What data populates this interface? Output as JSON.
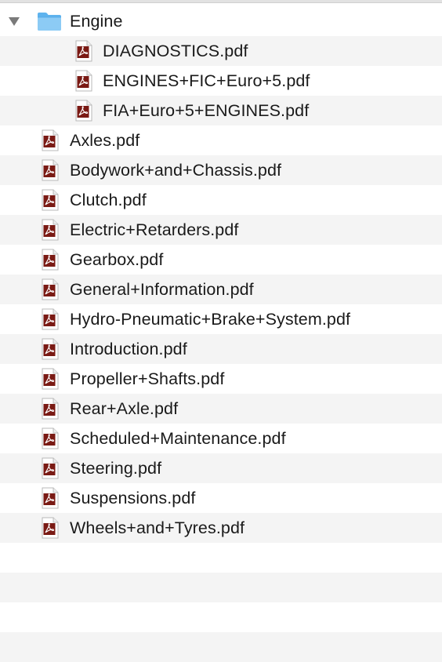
{
  "folder": {
    "name": "Engine",
    "expanded": true,
    "icon": "folder-icon",
    "color": "#6fbdf2",
    "children": [
      {
        "name": "DIAGNOSTICS.pdf",
        "icon": "pdf-icon"
      },
      {
        "name": "ENGINES+FIC+Euro+5.pdf",
        "icon": "pdf-icon"
      },
      {
        "name": "FIA+Euro+5+ENGINES.pdf",
        "icon": "pdf-icon"
      }
    ]
  },
  "files": [
    {
      "name": "Axles.pdf",
      "icon": "pdf-icon"
    },
    {
      "name": "Bodywork+and+Chassis.pdf",
      "icon": "pdf-icon"
    },
    {
      "name": "Clutch.pdf",
      "icon": "pdf-icon"
    },
    {
      "name": "Electric+Retarders.pdf",
      "icon": "pdf-icon"
    },
    {
      "name": "Gearbox.pdf",
      "icon": "pdf-icon"
    },
    {
      "name": "General+Information.pdf",
      "icon": "pdf-icon"
    },
    {
      "name": "Hydro-Pneumatic+Brake+System.pdf",
      "icon": "pdf-icon"
    },
    {
      "name": "Introduction.pdf",
      "icon": "pdf-icon"
    },
    {
      "name": "Propeller+Shafts.pdf",
      "icon": "pdf-icon"
    },
    {
      "name": "Rear+Axle.pdf",
      "icon": "pdf-icon"
    },
    {
      "name": "Scheduled+Maintenance.pdf",
      "icon": "pdf-icon"
    },
    {
      "name": "Steering.pdf",
      "icon": "pdf-icon"
    },
    {
      "name": "Suspensions.pdf",
      "icon": "pdf-icon"
    },
    {
      "name": "Wheels+and+Tyres.pdf",
      "icon": "pdf-icon"
    }
  ],
  "colors": {
    "row_alt": "#f4f4f4",
    "row": "#ffffff",
    "pdf_badge": "#7a1a14"
  }
}
